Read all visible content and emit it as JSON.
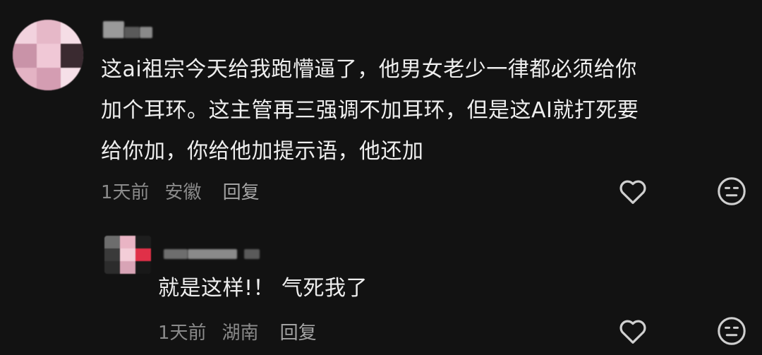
{
  "comments": [
    {
      "author_name": "",
      "lines": [
        "这ai祖宗今天给我跑懵逼了，他男女老少一律都必须给你",
        "加个耳环。这主管再三强调不加耳环，但是这AI就打死要",
        "给你加，你给他加提示语，他还加"
      ],
      "time": "1天前",
      "location": "安徽",
      "reply_label": "回复",
      "like_icon": "heart-outline-icon",
      "dislike_icon": "meh-face-icon"
    },
    {
      "author_name": "",
      "lines": [
        "就是这样!！ 气死我了"
      ],
      "time": "1天前",
      "location": "湖南",
      "reply_label": "回复",
      "like_icon": "heart-outline-icon",
      "dislike_icon": "meh-face-icon"
    }
  ],
  "colors": {
    "background": "#121212",
    "text": "#eeeeee",
    "meta": "#8a8a8a",
    "icon": "#cfcfcf"
  }
}
